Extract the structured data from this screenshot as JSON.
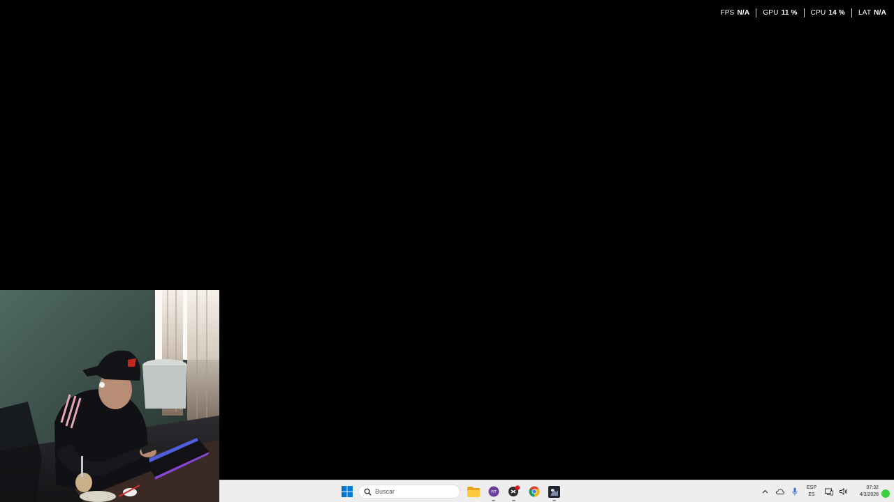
{
  "perf_overlay": {
    "fps_label": "FPS",
    "fps_value": "N/A",
    "gpu_label": "GPU",
    "gpu_value": "11 %",
    "cpu_label": "CPU",
    "cpu_value": "14 %",
    "lat_label": "LAT",
    "lat_value": "N/A"
  },
  "webcam": {
    "icon": "webcam-feed"
  },
  "taskbar": {
    "search_placeholder": "Buscar",
    "apps": [
      {
        "name": "file-explorer",
        "icon": "folder-icon"
      },
      {
        "name": "app-purple",
        "icon": "purple-app-icon"
      },
      {
        "name": "app-dark",
        "icon": "dark-app-icon",
        "badge_color": "#e81123"
      },
      {
        "name": "chrome",
        "icon": "chrome-icon"
      },
      {
        "name": "game",
        "icon": "game-icon"
      }
    ]
  },
  "tray": {
    "lang_top": "ESP",
    "lang_bottom": "ES",
    "time": "07:32",
    "date": "4/3/2026"
  },
  "colors": {
    "desktop": "#000000",
    "taskbar": "#eeeeee",
    "windows_blue": "#0078d4",
    "notification_green": "#3cd13c"
  }
}
